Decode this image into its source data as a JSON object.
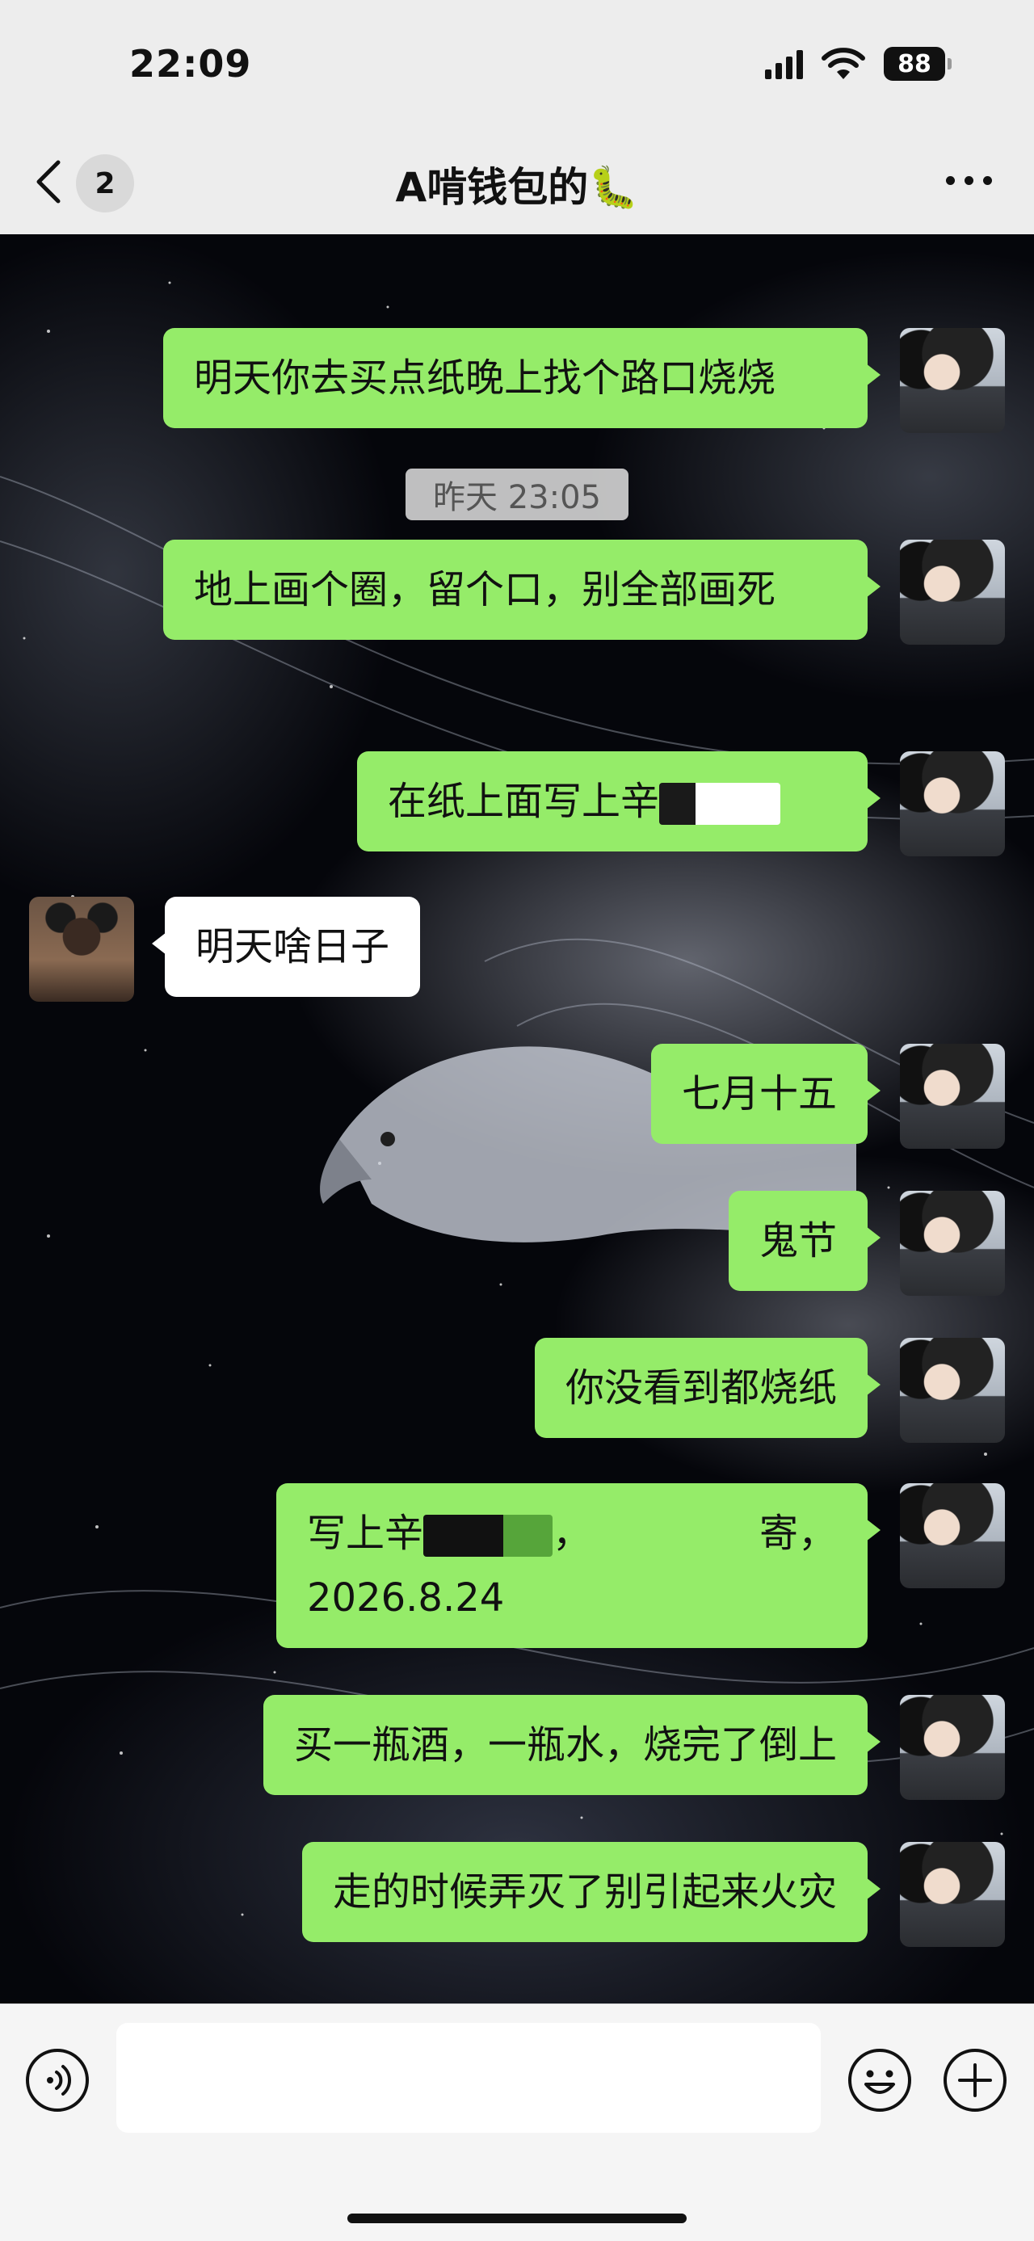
{
  "status_bar": {
    "time": "22:09",
    "battery": "88"
  },
  "header": {
    "unread_count": "2",
    "title": "A啃钱包的🐛"
  },
  "timestamp": "昨天 23:05",
  "messages": [
    {
      "sender": "me",
      "text": "明天你去买点纸晚上找个路口烧烧"
    },
    {
      "sender": "me",
      "text": "地上画个圈，留个口，别全部画死"
    },
    {
      "sender": "me",
      "text": "在纸上面写上辛"
    },
    {
      "sender": "friend",
      "text": "明天啥日子"
    },
    {
      "sender": "me",
      "text": "七月十五"
    },
    {
      "sender": "me",
      "text": "鬼节"
    },
    {
      "sender": "me",
      "text": "你没看到都烧纸"
    },
    {
      "sender": "me",
      "text_a": "写上辛",
      "text_b": "，",
      "text_c": "寄，",
      "text_d": "2026.8.24"
    },
    {
      "sender": "me",
      "text": "买一瓶酒，一瓶水，烧完了倒上"
    },
    {
      "sender": "me",
      "text": "走的时候弄灭了别引起来火灾"
    }
  ],
  "input": {
    "value": ""
  },
  "colors": {
    "my_bubble": "#95ec69",
    "their_bubble": "#ffffff",
    "header_bg": "#ededed"
  },
  "icons": [
    "back-icon",
    "more-icon",
    "voice-icon",
    "emoji-icon",
    "plus-icon"
  ]
}
